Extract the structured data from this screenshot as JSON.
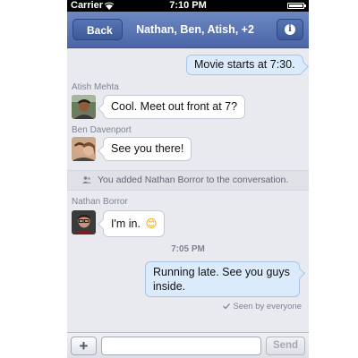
{
  "status_bar": {
    "carrier": "Carrier",
    "time": "7:10 PM"
  },
  "nav": {
    "back_label": "Back",
    "title": "Nathan, Ben, Atish, +2",
    "info_glyph": "i"
  },
  "messages": [
    {
      "direction": "out",
      "text": "Movie starts at 7:30."
    },
    {
      "direction": "in",
      "sender": "Atish Mehta",
      "text": "Cool. Meet out front at 7?"
    },
    {
      "direction": "in",
      "sender": "Ben Davenport",
      "text": "See you there!"
    },
    {
      "direction": "system",
      "text": "You added Nathan Borror to the conversation."
    },
    {
      "direction": "in",
      "sender": "Nathan Borror",
      "text": "I'm in.",
      "emoji": "😊"
    },
    {
      "direction": "timestamp",
      "text": "7:05 PM"
    },
    {
      "direction": "out",
      "text_line1": "Running late. See you guys",
      "text_line2": "inside.",
      "seen": "Seen by everyone"
    }
  ],
  "composer": {
    "add_label": "+",
    "input_value": "",
    "input_placeholder": "",
    "send_label": "Send"
  },
  "colors": {
    "nav": "#4a66a8",
    "background": "#e9eaef",
    "outgoing_bubble": "#dcebfb",
    "incoming_bubble": "#ffffff"
  }
}
